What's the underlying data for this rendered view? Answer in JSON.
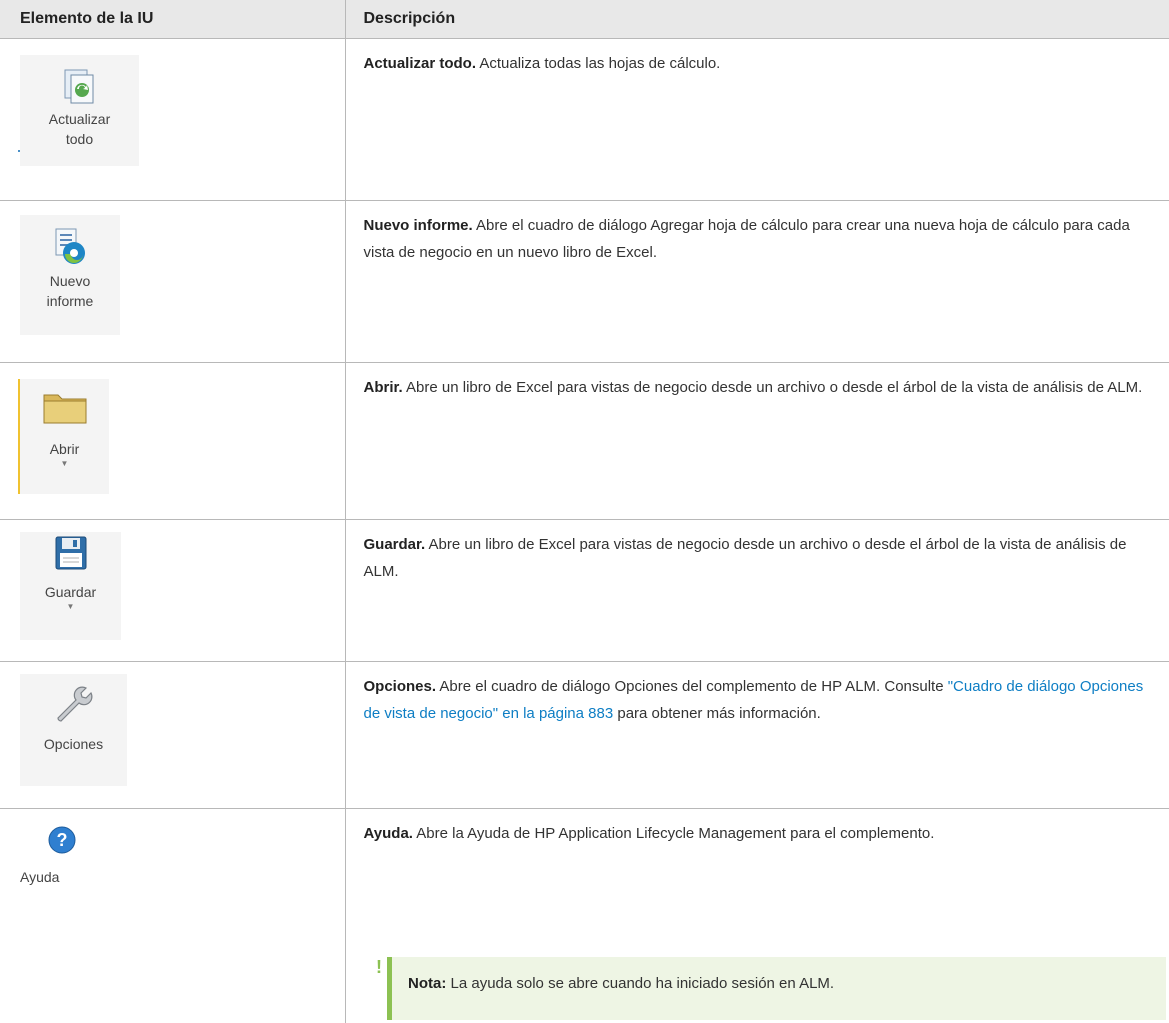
{
  "headers": {
    "col1": "Elemento de la IU",
    "col2": "Descripción"
  },
  "rows": [
    {
      "button_label_1": "Actualizar",
      "button_label_2": "todo",
      "icon": "refresh-document-icon",
      "title": "Actualizar todo.",
      "text": " Actualiza todas las hojas de cálculo."
    },
    {
      "button_label_1": "Nuevo",
      "button_label_2": "informe",
      "icon": "new-report-icon",
      "title": "Nuevo informe.",
      "text": " Abre el cuadro de diálogo Agregar hoja de cálculo para crear una nueva hoja de cálculo para cada vista de negocio en un nuevo libro de Excel."
    },
    {
      "button_label_1": "Abrir",
      "icon": "folder-icon",
      "title": "Abrir.",
      "text": " Abre un libro de Excel para vistas de negocio desde un archivo o desde el árbol de la vista de análisis de ALM."
    },
    {
      "button_label_1": "Guardar",
      "icon": "floppy-disk-icon",
      "title": "Guardar.",
      "text": " Abre un libro de Excel para vistas de negocio desde un archivo o desde el árbol de la vista de análisis de ALM."
    },
    {
      "button_label_1": "Opciones",
      "icon": "wrench-icon",
      "title": "Opciones.",
      "text": " Abre el cuadro de diálogo Opciones del complemento de HP ALM. Consulte ",
      "link": "\"Cuadro de diálogo Opciones de vista de negocio\" en la página 883",
      "text_after": " para obtener más información."
    },
    {
      "button_label_1": "Ayuda",
      "icon": "help-icon",
      "title": "Ayuda.",
      "text": " Abre la Ayuda de HP Application Lifecycle Management para el complemento.",
      "note_title": "Nota:",
      "note_text": " La ayuda solo se abre cuando ha iniciado sesión en ALM."
    }
  ],
  "colors": {
    "link": "#0e7ec4",
    "note_bg": "#eef5e4",
    "note_border": "#8cc152",
    "header_bg": "#e8e8e8"
  }
}
